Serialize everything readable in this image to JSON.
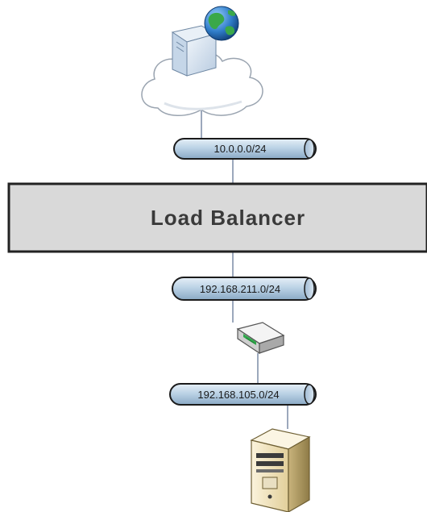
{
  "diagram": {
    "networks": {
      "internet_subnet": "10.0.0.0/24",
      "internal_subnet": "192.168.211.0/24",
      "server_subnet": "192.168.105.0/24"
    },
    "load_balancer": {
      "label": "Load Balancer"
    },
    "icons": {
      "internet": "cloud-server-globe-icon",
      "router": "router-icon",
      "server": "tower-server-icon"
    },
    "colors": {
      "pipe_fill": "#bcd3e6",
      "pipe_stroke": "#1b1b1b",
      "lb_fill": "#d9d9d9",
      "line": "#7a8aa6"
    }
  }
}
